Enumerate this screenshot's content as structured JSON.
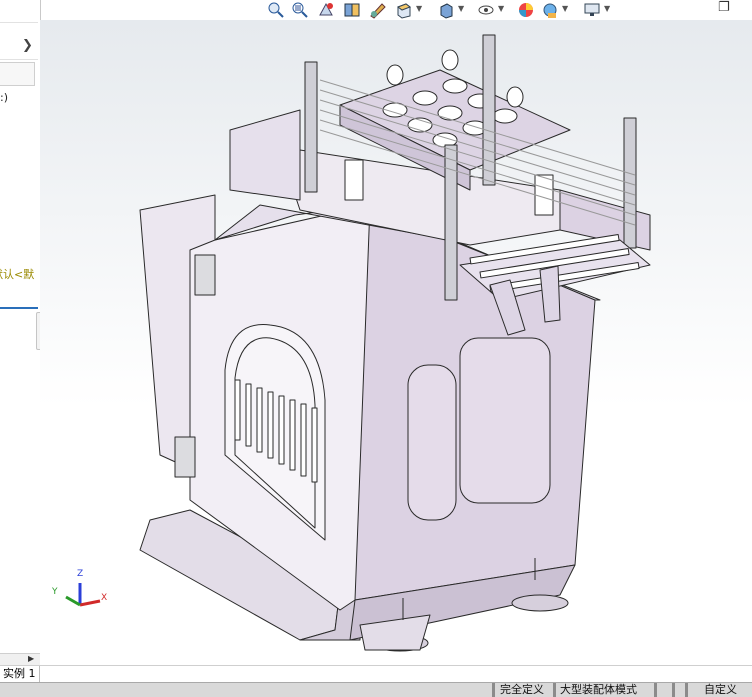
{
  "feature_manager": {
    "config_partial": "默认<默",
    "paren_partial": ":)",
    "collapse_glyph": "❯",
    "scroll_right_glyph": "▶"
  },
  "headsup_toolbar": {
    "icons": [
      "zoom-to-fit-icon",
      "zoom-area-icon",
      "previous-view-icon",
      "section-view-icon",
      "dynamic-annotation-icon",
      "view-orientation-icon",
      "display-style-icon",
      "hide-show-items-icon",
      "edit-appearance-icon",
      "apply-scene-icon",
      "view-settings-icon"
    ],
    "restore_glyph": "❐"
  },
  "triad": {
    "x": "X",
    "y": "Y",
    "z": "Z"
  },
  "tabs": {
    "instance": "实例 1"
  },
  "status_bar": {
    "fully_defined": "完全定义",
    "large_assembly": "大型装配体模式",
    "custom": "自定义"
  },
  "colors": {
    "body": "#e9e1ee",
    "outline": "#2a2a2a",
    "accent": "#2a6fba",
    "config_text": "#9a8a00"
  }
}
